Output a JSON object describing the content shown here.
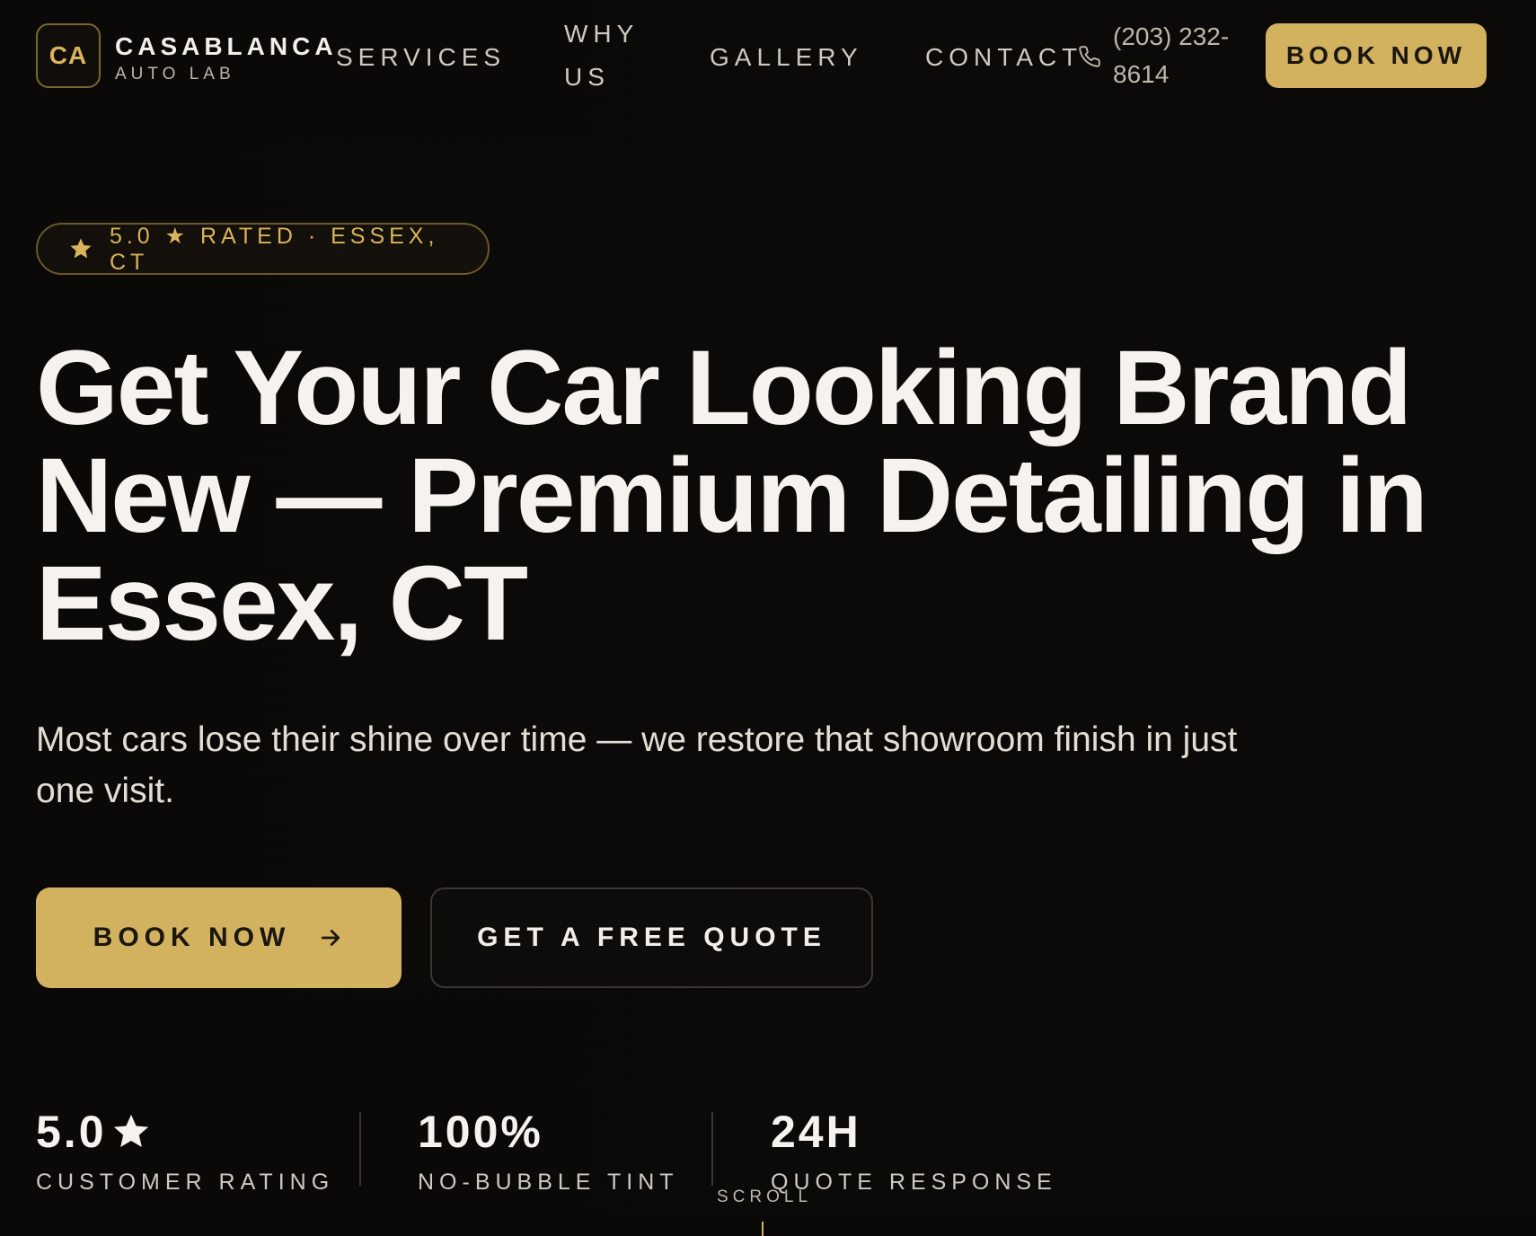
{
  "brand": {
    "logo_initials": "CA",
    "name": "CASABLANCA",
    "subtitle": "AUTO LAB"
  },
  "nav": {
    "links": [
      "SERVICES",
      "WHY US",
      "GALLERY",
      "CONTACT"
    ],
    "phone": "(203) 232-8614",
    "cta": "BOOK NOW",
    "phone_icon": "phone-icon"
  },
  "hero": {
    "rating_badge": "5.0 ★ RATED · ESSEX, CT",
    "badge_icon": "star-icon",
    "headline": "Get Your Car Looking Brand New — Premium Detailing in Essex, CT",
    "subtext": "Most cars lose their shine over time — we restore that showroom finish in just one visit.",
    "primary_cta": "BOOK NOW",
    "primary_cta_icon": "arrow-right-icon",
    "secondary_cta": "GET A FREE QUOTE"
  },
  "stats": [
    {
      "value": "5.0",
      "label": "CUSTOMER RATING",
      "icon": "star-icon"
    },
    {
      "value": "100%",
      "label": "NO-BUBBLE TINT"
    },
    {
      "value": "24H",
      "label": "QUOTE RESPONSE"
    }
  ],
  "scroll_label": "SCROLL",
  "colors": {
    "accent_gold": "#d3b25f",
    "background": "#0d0b09",
    "text_primary": "#f6f3ee"
  }
}
